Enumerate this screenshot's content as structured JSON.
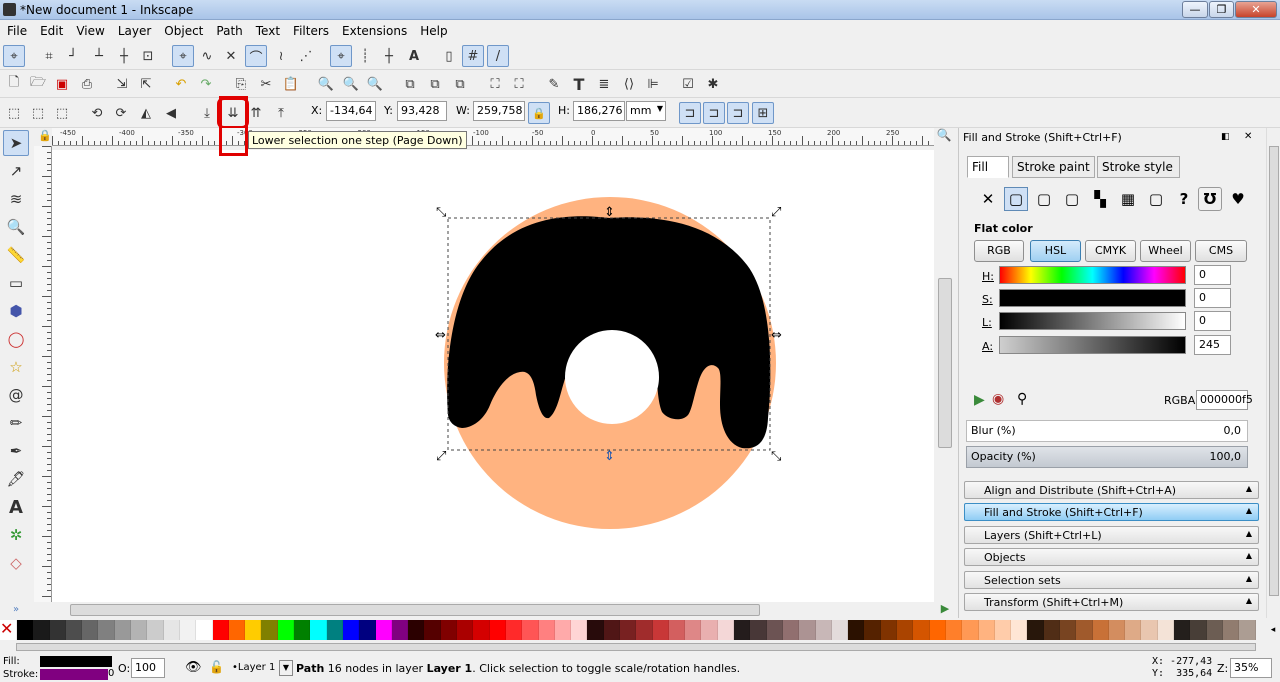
{
  "window": {
    "title": "*New document 1 - Inkscape",
    "min": "—",
    "max": "❐",
    "close": "✕"
  },
  "menu": [
    "File",
    "Edit",
    "View",
    "Layer",
    "Object",
    "Path",
    "Text",
    "Filters",
    "Extensions",
    "Help"
  ],
  "controls": {
    "x_label": "X:",
    "x": "-134,64",
    "y_label": "Y:",
    "y": "93,428",
    "w_label": "W:",
    "w": "259,758",
    "h_label": "H:",
    "h": "186,276",
    "unit": "mm"
  },
  "tooltip": "Lower selection one step (Page Down)",
  "ruler_h": [
    "-450",
    "-400",
    "-350",
    "-300",
    "-250",
    "-200",
    "-150",
    "-100",
    "-50",
    "0",
    "50",
    "100",
    "150",
    "200",
    "250"
  ],
  "panel": {
    "title": "Fill and Stroke (Shift+Ctrl+F)",
    "tabs": [
      "Fill",
      "Stroke paint",
      "Stroke style"
    ],
    "flat_color": "Flat color",
    "models": [
      "RGB",
      "HSL",
      "CMYK",
      "Wheel",
      "CMS"
    ],
    "sliders": [
      {
        "name": "H:",
        "value": "0"
      },
      {
        "name": "S:",
        "value": "0"
      },
      {
        "name": "L:",
        "value": "0"
      },
      {
        "name": "A:",
        "value": "245"
      }
    ],
    "rgba_label": "RGBA:",
    "rgba": "000000f5",
    "blur_label": "Blur (%)",
    "blur": "0,0",
    "opacity_label": "Opacity (%)",
    "opacity": "100,0",
    "docks": [
      "Align and Distribute (Shift+Ctrl+A)",
      "Fill and Stroke (Shift+Ctrl+F)",
      "Layers (Shift+Ctrl+L)",
      "Objects",
      "Selection sets",
      "Transform (Shift+Ctrl+M)"
    ]
  },
  "status": {
    "fill_label": "Fill:",
    "stroke_label": "Stroke:",
    "stroke_width": "0",
    "opacity_label": "O:",
    "opacity": "100",
    "layer": "•Layer 1",
    "message_path": "Path",
    "message_rest": " 16 nodes in layer ",
    "message_layer": "Layer 1",
    "message_tail": ". Click selection to toggle scale/rotation handles.",
    "x": "X: -277,43",
    "y": "Y:  335,64",
    "zoom_label": "Z:",
    "zoom": "35%"
  },
  "colors": {
    "fill": "#000000",
    "donut": "#ffb380",
    "stroke": "#800080",
    "accent": "#cfe0f5"
  }
}
